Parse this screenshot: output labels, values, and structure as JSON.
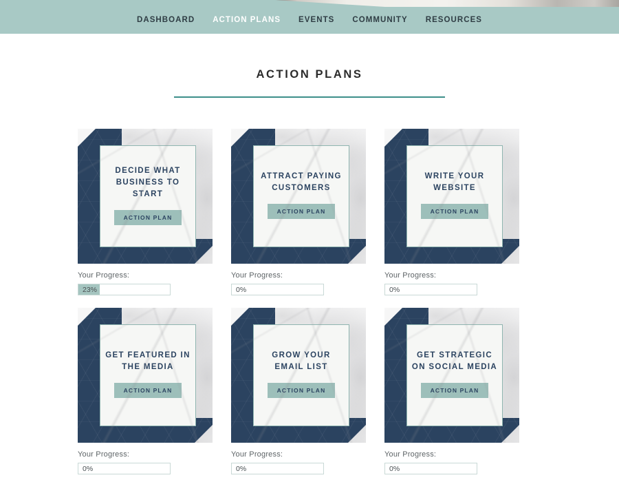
{
  "nav": {
    "items": [
      {
        "label": "DASHBOARD",
        "active": false
      },
      {
        "label": "ACTION PLANS",
        "active": true
      },
      {
        "label": "EVENTS",
        "active": false
      },
      {
        "label": "COMMUNITY",
        "active": false
      },
      {
        "label": "RESOURCES",
        "active": false
      }
    ],
    "background_color": "#a8c9c5",
    "active_color": "#ffffff",
    "text_color": "#2f3d44"
  },
  "page": {
    "title": "ACTION PLANS",
    "rule_color": "#3d8f8a"
  },
  "colors": {
    "navy": "#2b4360",
    "sage": "#9dbfba",
    "teal_border": "#8fb5b0",
    "progress_fill": "#a5c5c0"
  },
  "progress_label": "Your Progress:",
  "button_label": "ACTION PLAN",
  "cards": [
    {
      "title": "DECIDE WHAT BUSINESS TO START",
      "button": "ACTION PLAN",
      "progress_label": "Your Progress:",
      "progress_text": "23%",
      "progress_value": 23
    },
    {
      "title": "ATTRACT PAYING CUSTOMERS",
      "button": "ACTION PLAN",
      "progress_label": "Your Progress:",
      "progress_text": "0%",
      "progress_value": 0
    },
    {
      "title": "WRITE YOUR WEBSITE",
      "button": "ACTION PLAN",
      "progress_label": "Your Progress:",
      "progress_text": "0%",
      "progress_value": 0
    },
    {
      "title": "GET FEATURED IN THE MEDIA",
      "button": "ACTION PLAN",
      "progress_label": "Your Progress:",
      "progress_text": "0%",
      "progress_value": 0
    },
    {
      "title": "GROW YOUR EMAIL LIST",
      "button": "ACTION PLAN",
      "progress_label": "Your Progress:",
      "progress_text": "0%",
      "progress_value": 0
    },
    {
      "title": "GET STRATEGIC ON SOCIAL MEDIA",
      "button": "ACTION PLAN",
      "progress_label": "Your Progress:",
      "progress_text": "0%",
      "progress_value": 0
    }
  ]
}
